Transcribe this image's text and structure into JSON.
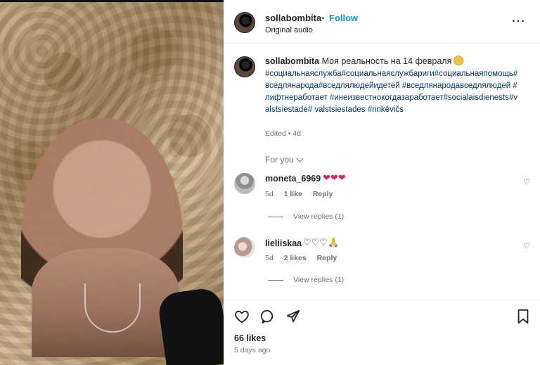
{
  "post": {
    "username": "sollabombita",
    "follow_label": "Follow",
    "audio_label": "Original audio"
  },
  "caption": {
    "username": "sollabombita",
    "text": "Моя реальность на 14 февраля",
    "hashtags": "#социальнаяслужба#социальнаяслужбариги#социальнаяпомощь#вседлянарода#вседлялюдейидетей #вседлянародавседлялюдей #лифтнеработает #инеизвестнокогдазаработает#socialaisdienests#valstsiestade# valstsiestades #rinkēvičs",
    "edited": "Edited • 4d"
  },
  "for_you_label": "For you",
  "comments": [
    {
      "username": "moneta_6969",
      "text": "❤❤❤",
      "age": "5d",
      "likes": "1 like",
      "reply_label": "Reply",
      "view_replies": "View replies (1)"
    },
    {
      "username": "lieliiskaa",
      "text": "♡♡♡🙏",
      "age": "5d",
      "likes": "2 likes",
      "reply_label": "Reply",
      "view_replies": "View replies (1)"
    }
  ],
  "footer": {
    "likes": "66 likes",
    "time_ago": "5 days ago"
  },
  "colors": {
    "link": "#0095f6",
    "hashtag": "#00376b",
    "muted": "#737373",
    "text": "#262626",
    "heart": "#e0245e"
  },
  "icons": {
    "more": "more-options-icon",
    "like": "heart-icon",
    "comment": "comment-icon",
    "share": "share-icon",
    "save": "bookmark-icon",
    "chevron": "chevron-down-icon"
  }
}
